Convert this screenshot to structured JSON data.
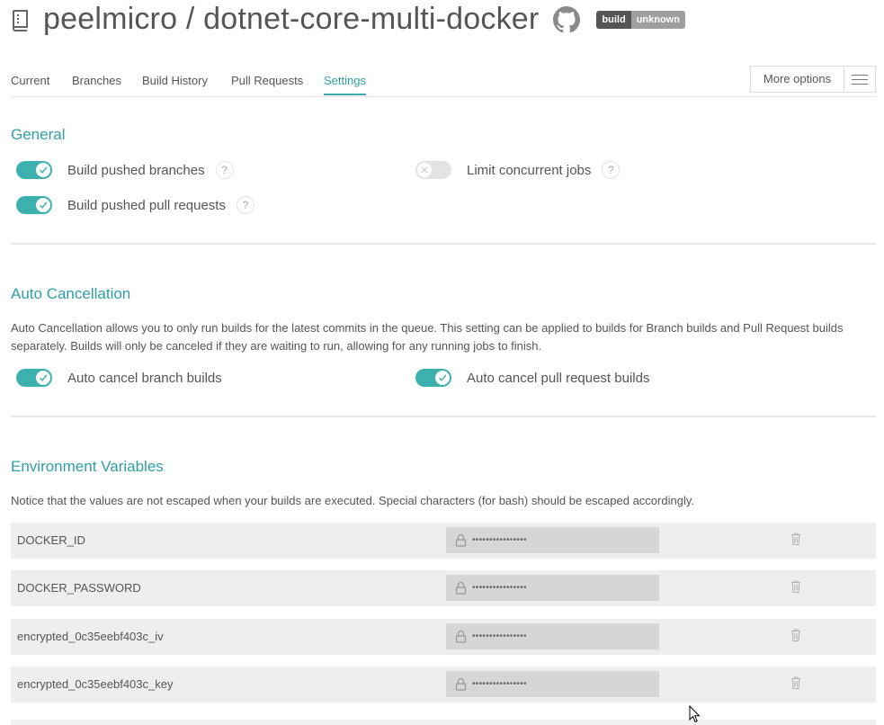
{
  "header": {
    "title": "peelmicro / dotnet-core-multi-docker",
    "repo_icon": "repo-book-icon",
    "github_icon": "github-icon",
    "badge": {
      "left": "build",
      "right": "unknown"
    }
  },
  "tabs": [
    {
      "label": "Current",
      "active": false
    },
    {
      "label": "Branches",
      "active": false
    },
    {
      "label": "Build History",
      "active": false
    },
    {
      "label": "Pull Requests",
      "active": false
    },
    {
      "label": "Settings",
      "active": true
    }
  ],
  "more_options": {
    "label": "More options",
    "icon": "hamburger-menu-icon"
  },
  "general": {
    "title": "General",
    "settings": [
      {
        "label": "Build pushed branches",
        "enabled": true,
        "help": "?"
      },
      {
        "label": "Limit concurrent jobs",
        "enabled": false,
        "help": "?"
      },
      {
        "label": "Build pushed pull requests",
        "enabled": true,
        "help": "?"
      }
    ]
  },
  "auto_cancellation": {
    "title": "Auto Cancellation",
    "description": "Auto Cancellation allows you to only run builds for the latest commits in the queue. This setting can be applied to builds for Branch builds and Pull Request builds separately. Builds will only be canceled if they are waiting to run, allowing for any running jobs to finish.",
    "settings": [
      {
        "label": "Auto cancel branch builds",
        "enabled": true
      },
      {
        "label": "Auto cancel pull request builds",
        "enabled": true
      }
    ]
  },
  "env_vars": {
    "title": "Environment Variables",
    "notice": "Notice that the values are not escaped when your builds are executed. Special characters (for bash) should be escaped accordingly.",
    "rows": [
      {
        "name": "DOCKER_ID",
        "value": "••••••••••••••••"
      },
      {
        "name": "DOCKER_PASSWORD",
        "value": "••••••••••••••••"
      },
      {
        "name": "encrypted_0c35eebf403c_iv",
        "value": "••••••••••••••••"
      },
      {
        "name": "encrypted_0c35eebf403c_key",
        "value": "••••••••••••••••"
      }
    ]
  },
  "colors": {
    "accent": "#39aaae",
    "toggle_on": "#3bb0ae",
    "toggle_off": "#e3e3e3",
    "badge_dark": "#555555",
    "badge_unknown": "#9f9f9f"
  }
}
